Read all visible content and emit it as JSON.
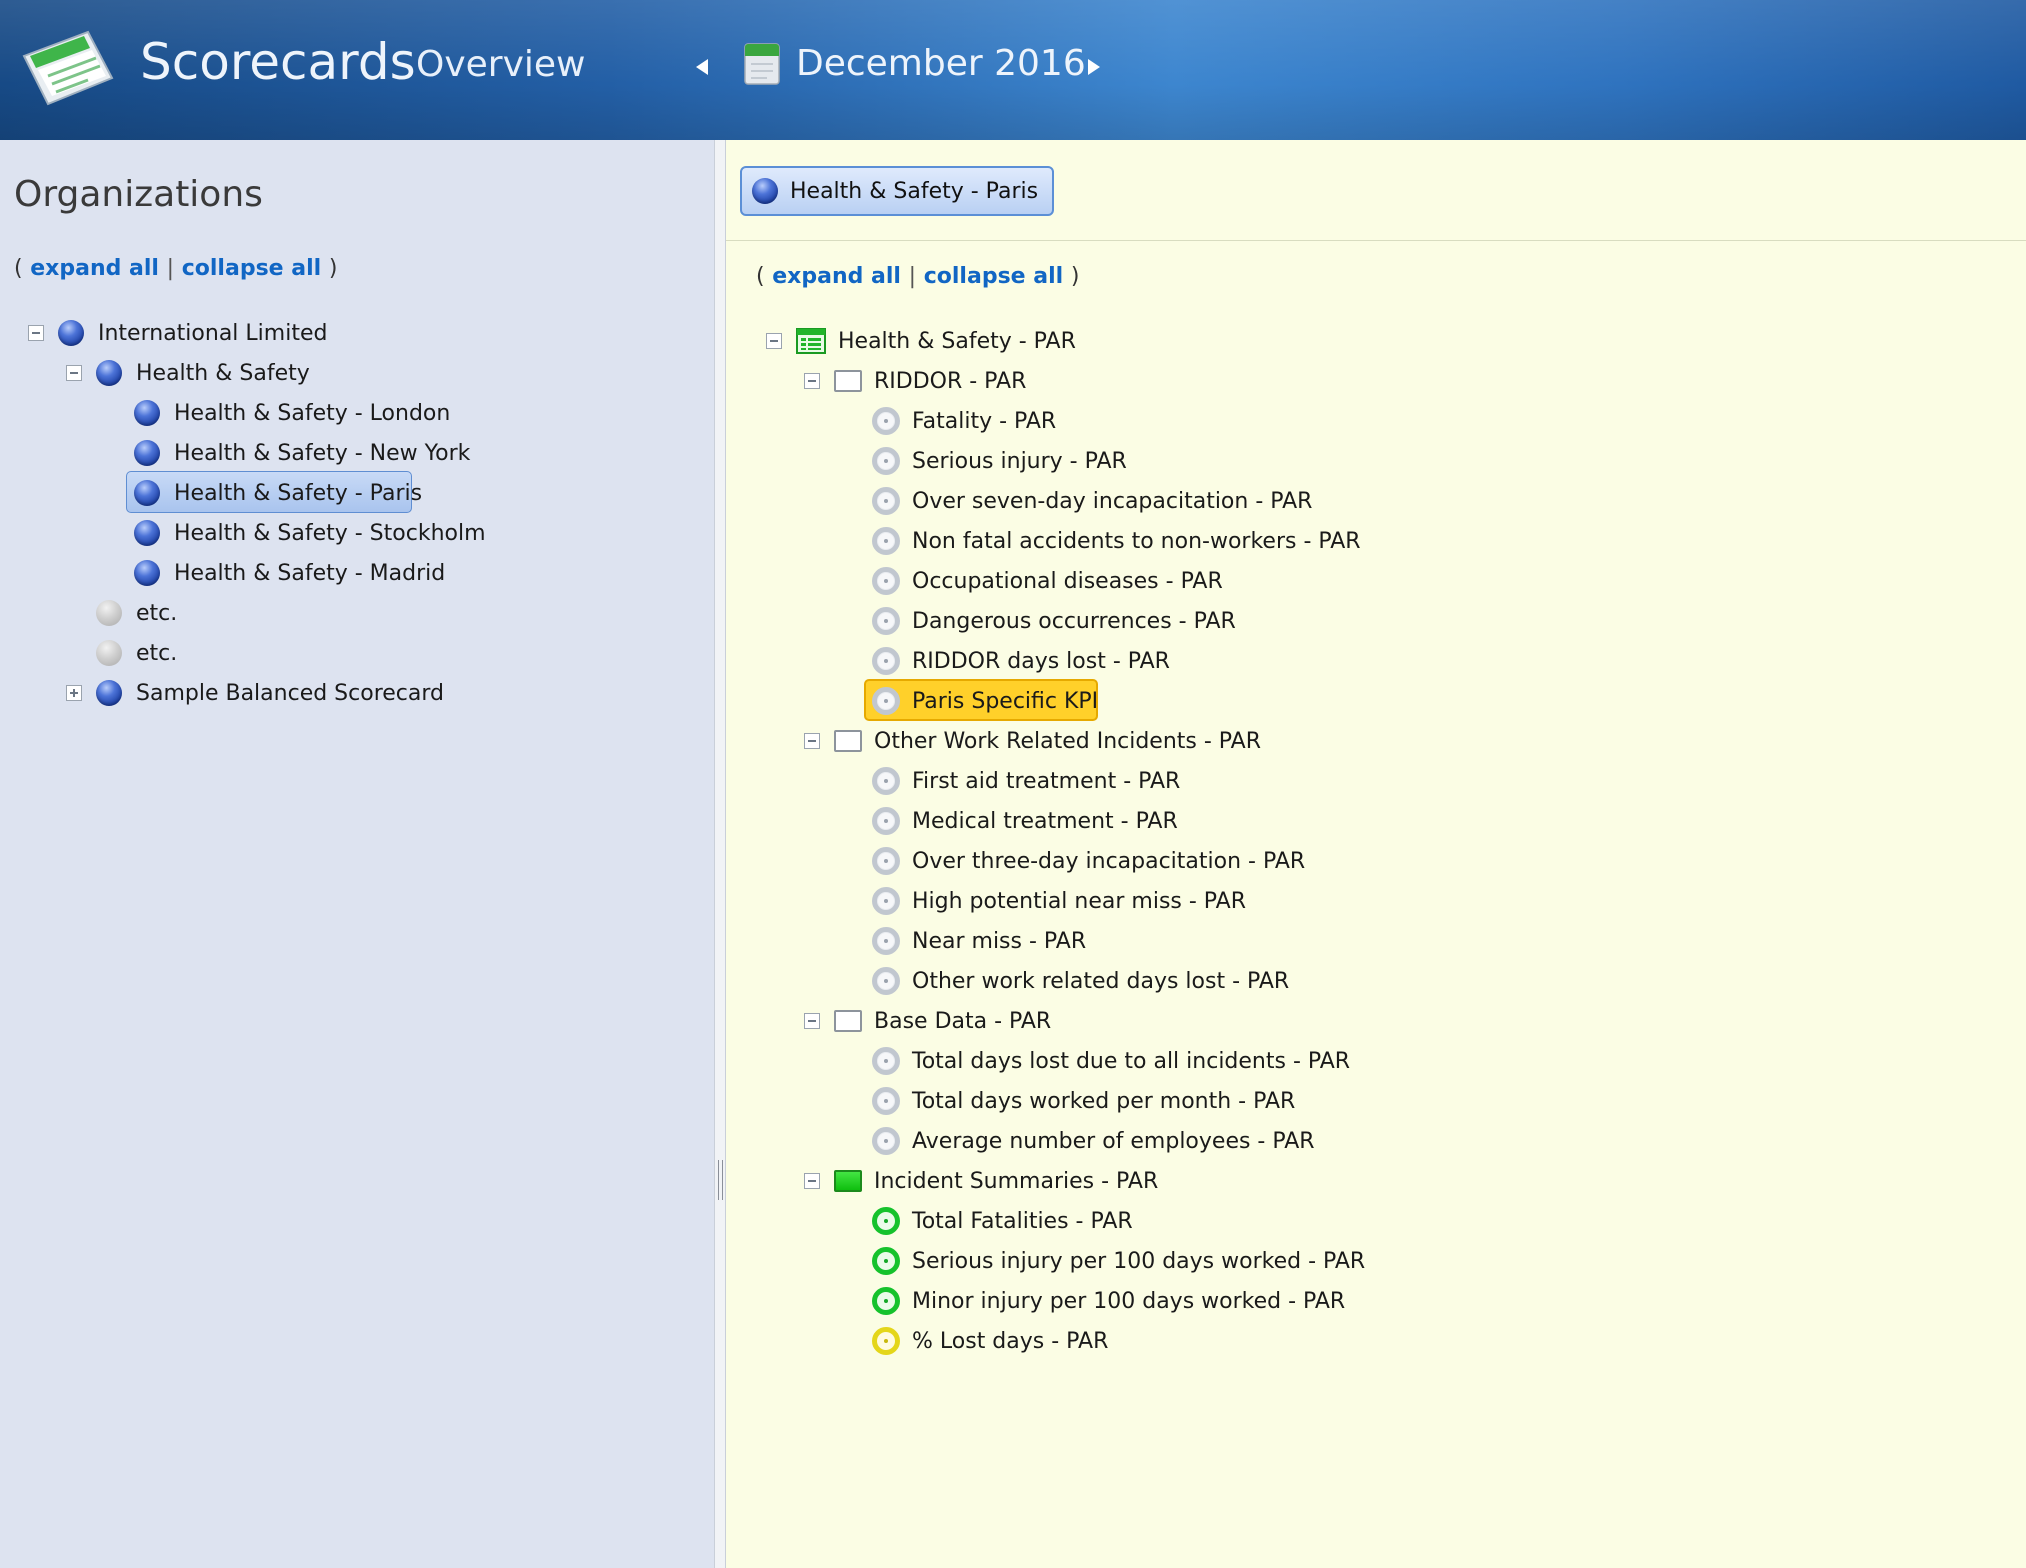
{
  "header": {
    "app_title": "Scorecards",
    "tab_overview": "Overview",
    "period": "December 2016"
  },
  "left": {
    "title": "Organizations",
    "links": {
      "open": "(",
      "expand": "expand all",
      "sep": "|",
      "collapse": "collapse all",
      "close": ")"
    },
    "tree": [
      {
        "label": "International Limited",
        "level": 0,
        "toggle": "minus",
        "icon": "blue-orb"
      },
      {
        "label": "Health & Safety",
        "level": 1,
        "toggle": "minus",
        "icon": "blue-orb"
      },
      {
        "label": "Health & Safety - London",
        "level": 2,
        "icon": "blue-orb"
      },
      {
        "label": "Health & Safety - New York",
        "level": 2,
        "icon": "blue-orb"
      },
      {
        "label": "Health & Safety - Paris",
        "level": 2,
        "icon": "blue-orb",
        "selected": true
      },
      {
        "label": "Health & Safety - Stockholm",
        "level": 2,
        "icon": "blue-orb"
      },
      {
        "label": "Health & Safety - Madrid",
        "level": 2,
        "icon": "blue-orb"
      },
      {
        "label": "etc.",
        "level": 1,
        "icon": "grey-orb"
      },
      {
        "label": "etc.",
        "level": 1,
        "icon": "grey-orb"
      },
      {
        "label": "Sample Balanced Scorecard",
        "level": 1,
        "toggle": "plus",
        "icon": "blue-orb"
      }
    ]
  },
  "right": {
    "org_chip": "Health & Safety - Paris",
    "links": {
      "open": "(",
      "expand": "expand all",
      "sep": "|",
      "collapse": "collapse all",
      "close": ")"
    },
    "tree": [
      {
        "label": "Health & Safety - PAR",
        "level": 0,
        "toggle": "minus",
        "icon": "scorecard"
      },
      {
        "label": "RIDDOR - PAR",
        "level": 1,
        "toggle": "minus",
        "icon": "white-box"
      },
      {
        "label": "Fatality - PAR",
        "level": 2,
        "icon": "kpi-grey"
      },
      {
        "label": "Serious injury - PAR",
        "level": 2,
        "icon": "kpi-grey"
      },
      {
        "label": "Over seven-day incapacitation - PAR",
        "level": 2,
        "icon": "kpi-grey"
      },
      {
        "label": "Non fatal accidents to non-workers - PAR",
        "level": 2,
        "icon": "kpi-grey"
      },
      {
        "label": "Occupational diseases - PAR",
        "level": 2,
        "icon": "kpi-grey"
      },
      {
        "label": "Dangerous occurrences - PAR",
        "level": 2,
        "icon": "kpi-grey"
      },
      {
        "label": "RIDDOR days lost - PAR",
        "level": 2,
        "icon": "kpi-grey"
      },
      {
        "label": "Paris Specific KPI",
        "level": 2,
        "icon": "kpi-grey",
        "highlighted": true
      },
      {
        "label": "Other Work Related Incidents - PAR",
        "level": 1,
        "toggle": "minus",
        "icon": "white-box"
      },
      {
        "label": "First aid treatment - PAR",
        "level": 2,
        "icon": "kpi-grey"
      },
      {
        "label": "Medical treatment - PAR",
        "level": 2,
        "icon": "kpi-grey"
      },
      {
        "label": "Over three-day incapacitation - PAR",
        "level": 2,
        "icon": "kpi-grey"
      },
      {
        "label": "High potential near miss - PAR",
        "level": 2,
        "icon": "kpi-grey"
      },
      {
        "label": "Near miss - PAR",
        "level": 2,
        "icon": "kpi-grey"
      },
      {
        "label": "Other work related days lost - PAR",
        "level": 2,
        "icon": "kpi-grey"
      },
      {
        "label": "Base Data - PAR",
        "level": 1,
        "toggle": "minus",
        "icon": "white-box"
      },
      {
        "label": "Total days lost due to all incidents - PAR",
        "level": 2,
        "icon": "kpi-grey"
      },
      {
        "label": "Total days worked per month - PAR",
        "level": 2,
        "icon": "kpi-grey"
      },
      {
        "label": "Average number of employees - PAR",
        "level": 2,
        "icon": "kpi-grey"
      },
      {
        "label": "Incident Summaries - PAR",
        "level": 1,
        "toggle": "minus",
        "icon": "green-box"
      },
      {
        "label": "Total Fatalities - PAR",
        "level": 2,
        "icon": "kpi-green"
      },
      {
        "label": "Serious injury per 100 days worked - PAR",
        "level": 2,
        "icon": "kpi-green"
      },
      {
        "label": "Minor injury per 100 days worked - PAR",
        "level": 2,
        "icon": "kpi-green"
      },
      {
        "label": "% Lost days - PAR",
        "level": 2,
        "icon": "kpi-yellow"
      }
    ]
  },
  "colors": {
    "header_blue": "#235fa6",
    "left_bg": "#dde3f0",
    "right_bg": "#fbfde4",
    "link": "#1166c4",
    "highlight": "#ffd02a",
    "status_green": "#16c22c",
    "status_yellow": "#e4d61a"
  }
}
